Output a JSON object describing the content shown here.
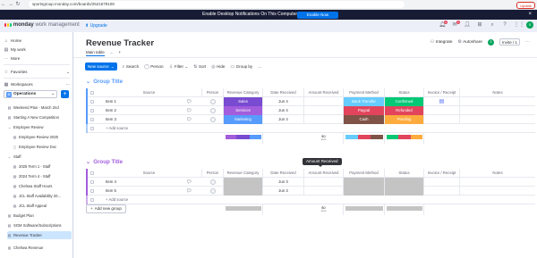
{
  "browser": {
    "url": "sportsgroup.monday.com/boards/2521679109",
    "update_label": "Update"
  },
  "banner": {
    "text": "Enable Desktop Notifications On This Computer",
    "button": "Enable Now"
  },
  "app": {
    "logo_bold": "monday",
    "logo_light": "work management",
    "upgrade": "Upgrade",
    "badge_notifications": "4",
    "badge_inbox": "1",
    "avatar": "S"
  },
  "sidebar": {
    "home": "Home",
    "my_work": "My work",
    "more": "More",
    "favorites": "Favorites",
    "workspaces": "Workspaces",
    "workspace_name": "Operations",
    "workspace_letter": "O",
    "items": [
      "Weekend Plan - March 2nd",
      "Starting A New Competition",
      "Employee Review",
      "Employee Review 2025",
      "Employee Review Doc",
      "Staff",
      "2025 Term 1 - Staff",
      "2024 Term 4 - Staff",
      "Chelsea Staff Hours",
      "JCL Staff Availability 20...",
      "JCL Staff Appeal",
      "Budget Plan",
      "SGM Software/Subscriptions",
      "Revenue Tracker",
      "Chelsea Revenue"
    ]
  },
  "board": {
    "title": "Revenue Tracker",
    "integrate": "Integrate",
    "autoshare": "Autoshare",
    "invite": "Invite / 1",
    "tabs": [
      "Main table"
    ],
    "tab_more": "...",
    "tab_add": "+",
    "toolbar": {
      "new": "New source",
      "search": "Search",
      "person": "Person",
      "filter": "Filter",
      "sort": "Sort",
      "hide": "Hide",
      "group_by": "Group by",
      "more": "..."
    },
    "columns": [
      "Source",
      "Person",
      "Revenue Category",
      "Date Received",
      "Amount Received",
      "Payment Method",
      "Status",
      "Invoice / Receipt",
      "Notes"
    ],
    "add_source": "+ Add source",
    "add_group": "Add new group"
  },
  "groups": [
    {
      "title": "Group Title",
      "color": "#579bfc",
      "rows": [
        {
          "name": "Item 1",
          "category": "Sales",
          "category_color": "#784bd1",
          "date": "Jun 4",
          "payment": "Bank Transfer",
          "payment_color": "#66ccff",
          "status": "Confirmed",
          "status_color": "#00c875",
          "has_file": true
        },
        {
          "name": "Item 2",
          "category": "Services",
          "category_color": "#a25ddc",
          "date": "Jun 4",
          "payment": "Paypal",
          "payment_color": "#e2445c",
          "status": "Refunded",
          "status_color": "#e2445c",
          "has_file": false
        },
        {
          "name": "Item 3",
          "category": "Marketing",
          "category_color": "#579bfc",
          "date": "Jun 4",
          "payment": "Cash",
          "payment_color": "#7f5347",
          "status": "Pending",
          "status_color": "#fdab3d",
          "has_file": false
        }
      ],
      "sum_value": "$0",
      "sum_label": "sum",
      "category_summary": [
        "#a25ddc",
        "#784bd1",
        "#579bfc"
      ],
      "payment_summary": [
        "#66ccff",
        "#e2445c",
        "#7f5347"
      ],
      "status_summary": [
        "#00c875",
        "#e2445c",
        "#fdab3d"
      ]
    },
    {
      "title": "Group Title",
      "color": "#a25ddc",
      "rows": [
        {
          "name": "Item 4",
          "date": "Jun 3"
        },
        {
          "name": "Item 5",
          "date": "Jun 3"
        }
      ],
      "sum_value": "$0",
      "sum_label": "sum"
    }
  ],
  "tooltip": "Amount Received"
}
